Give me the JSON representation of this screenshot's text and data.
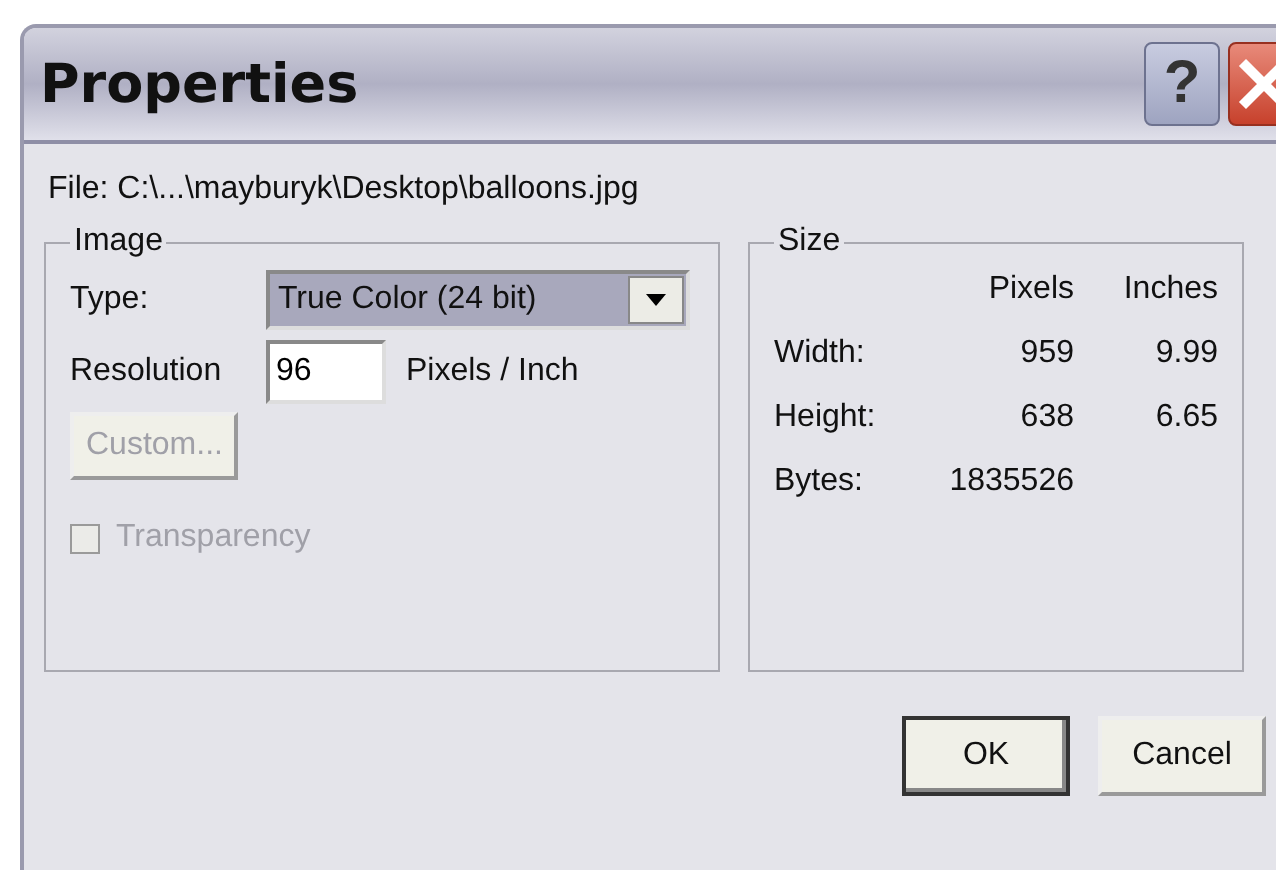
{
  "window": {
    "title": "Properties",
    "help_button": "?"
  },
  "file_line": "File:  C:\\...\\mayburyk\\Desktop\\balloons.jpg",
  "image_group": {
    "title": "Image",
    "type_label": "Type:",
    "type_value": "True Color (24 bit)",
    "resolution_label": "Resolution",
    "resolution_value": "96",
    "resolution_unit": "Pixels / Inch",
    "custom_button": {
      "label": "Custom...",
      "disabled": true
    },
    "transparency": {
      "label": "Transparency",
      "checked": false,
      "disabled": true
    }
  },
  "size_group": {
    "title": "Size",
    "columns": [
      "Pixels",
      "Inches"
    ],
    "rows": [
      {
        "label": "Width:",
        "values": [
          "959",
          "9.99"
        ]
      },
      {
        "label": "Height:",
        "values": [
          "638",
          "6.65"
        ]
      },
      {
        "label": "Bytes:",
        "values": [
          "1835526"
        ]
      }
    ]
  },
  "buttons": [
    {
      "label": "OK",
      "default": true
    },
    {
      "label": "Cancel",
      "default": false
    }
  ]
}
